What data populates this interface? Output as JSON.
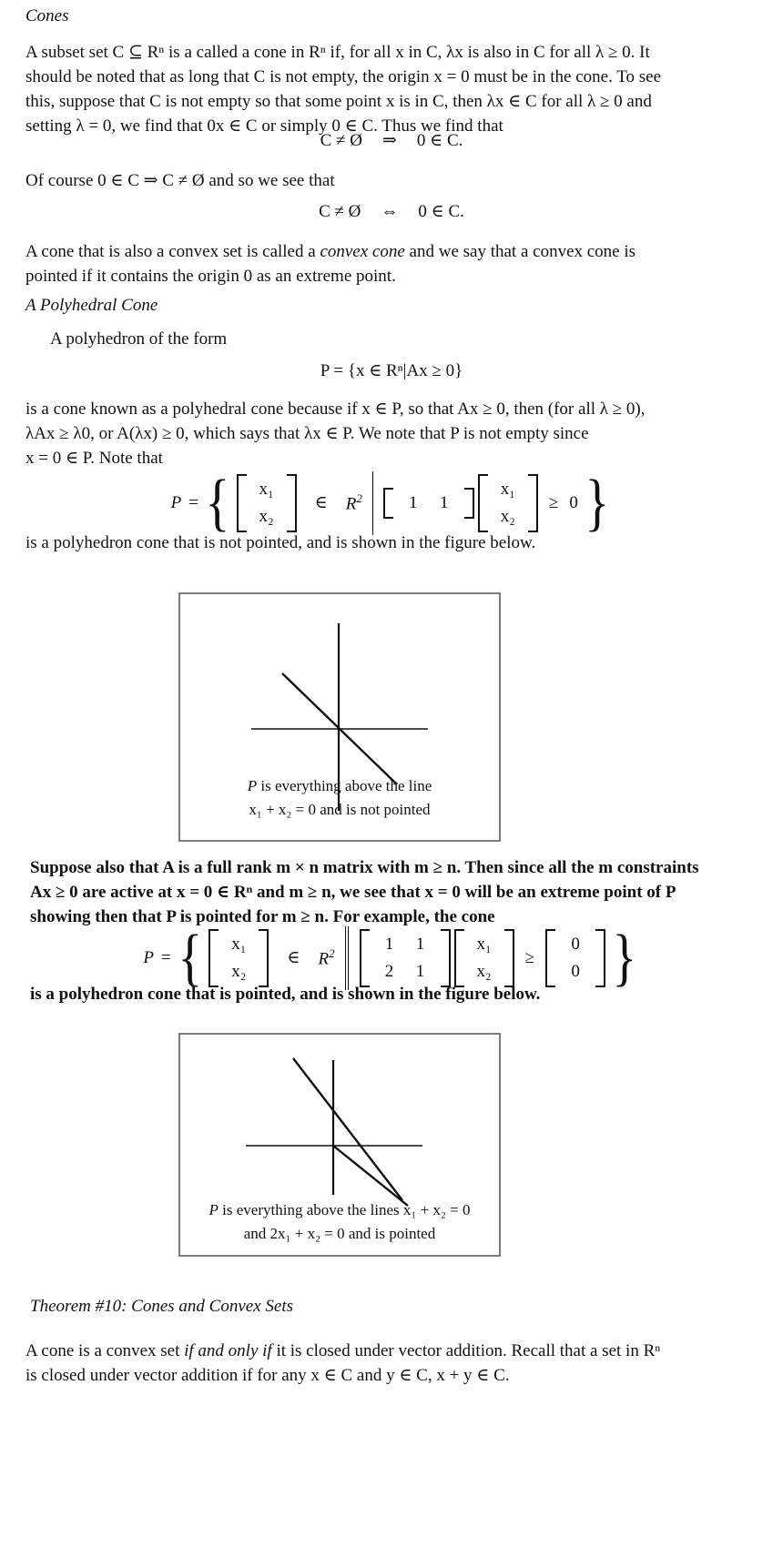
{
  "document": {
    "section_title": "Cones",
    "paragraph_1": {
      "line1": "A subset set C ⊆ Rⁿ is a called a cone in Rⁿ if, for all x in C, λx is also in C for all λ ≥ 0. It",
      "line2": "should be noted that as long that C is not empty, the origin x = 0 must be in the cone. To see",
      "line3": "this, suppose that C is not empty so that some point x is in C, then λx ∈ C for all λ ≥ 0 and",
      "line4": "setting λ = 0, we find that 0x ∈ C or simply 0 ∈ C. Thus we find that"
    },
    "equation_1": {
      "left": "C ≠ Ø",
      "op": "⇒",
      "right": "0 ∈ C."
    },
    "paragraph_2": "Of course 0 ∈ C ⇒ C ≠ Ø and so we see that",
    "equation_2": {
      "left": "C ≠ Ø",
      "op": "⇔",
      "right": "0 ∈ C."
    },
    "paragraph_3": {
      "line1": "A cone that is also a convex set is called a convex cone and we say that a convex cone is",
      "line2": "pointed if it contains the origin 0 as an extreme point.",
      "italic_phrase": "convex cone"
    },
    "subsection_title": "A Polyhedral Cone",
    "paragraph_4": "A polyhedron of the form",
    "equation_3": "P = {x ∈ Rⁿ|Ax ≥ 0}",
    "paragraph_5": {
      "line1": "is a cone known as a polyhedral cone because if x ∈ P, so that Ax ≥ 0, then (for all λ ≥ 0),",
      "line2": "λAx ≥ λ0, or A(λx) ≥ 0, which says that λx ∈ P. We note that P is not empty since",
      "line3": "x = 0 ∈ P. Note that"
    },
    "equation_4": {
      "label": "P",
      "equals": "=",
      "vector": [
        "x₁",
        "x₂"
      ],
      "member_of": "∈",
      "space": "R",
      "space_exp": "2",
      "matrix_rows": [
        [
          "1",
          "1"
        ]
      ],
      "vector2": [
        "x₁",
        "x₂"
      ],
      "relation": "≥",
      "rhs": "0"
    },
    "paragraph_6": "is a polyhedron cone that is not pointed, and is shown in the figure below.",
    "figure_1": {
      "caption_line1": "P is everything above the line",
      "caption_line2": "x₁ + x₂ = 0 and is not pointed",
      "caption_italic_symbol": "P",
      "line_equation": "x1 + x2 = 0",
      "slope": -1,
      "axis_color": "#111111",
      "border_color": "#7b7b7b"
    },
    "paragraph_7": {
      "line1": "Suppose also that A is a full rank m × n matrix with m ≥ n. Then since all the m constraints",
      "line2": "Ax ≥ 0 are active at x = 0 ∈ Rⁿ and m ≥ n, we see that x = 0 will be an extreme point of P",
      "line3": "showing then that P is pointed for m ≥ n. For example, the cone"
    },
    "equation_5": {
      "label": "P",
      "equals": "=",
      "vector": [
        "x₁",
        "x₂"
      ],
      "member_of": "∈",
      "space": "R",
      "space_exp": "2",
      "matrix_rows": [
        [
          "1",
          "1"
        ],
        [
          "2",
          "1"
        ]
      ],
      "vector2": [
        "x₁",
        "x₂"
      ],
      "relation": "≥",
      "rhs_vector": [
        "0",
        "0"
      ]
    },
    "paragraph_8": "is a polyhedron cone that is pointed, and is shown in the figure below.",
    "figure_2": {
      "caption_line1": "P is everything above the lines x₁ + x₂ = 0",
      "caption_line2": "and 2x₁ + x₂ = 0 and is pointed",
      "caption_italic_symbol": "P",
      "line_equation_1": "x1 + x2 = 0",
      "line_equation_2": "2x1 + x2 = 0",
      "slope_1": -1,
      "slope_2": -2,
      "axis_color": "#111111",
      "border_color": "#7b7b7b"
    },
    "theorem_title": "Theorem #10: Cones and Convex Sets",
    "paragraph_9": {
      "line1": "A cone is a convex set if and only if it is closed under vector addition. Recall that a set in Rⁿ",
      "line2": "is closed under vector addition if for any x ∈ C and y ∈ C, x + y ∈ C.",
      "italic_phrase": "if and only if"
    }
  }
}
